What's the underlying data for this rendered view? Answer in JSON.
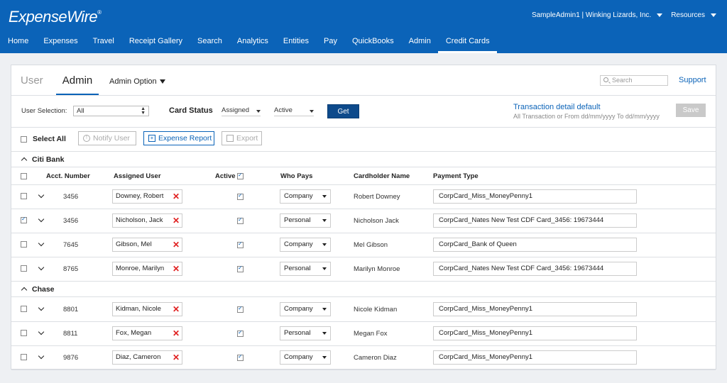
{
  "app": {
    "logo": "ExpenseWire",
    "logo_mark": "®"
  },
  "account": {
    "user": "SampleAdmin1 | Winking Lizards, Inc.",
    "resources": "Resources"
  },
  "nav": [
    {
      "label": "Home"
    },
    {
      "label": "Expenses"
    },
    {
      "label": "Travel"
    },
    {
      "label": "Receipt Gallery"
    },
    {
      "label": "Search"
    },
    {
      "label": "Analytics"
    },
    {
      "label": "Entities"
    },
    {
      "label": "Pay"
    },
    {
      "label": "QuickBooks"
    },
    {
      "label": "Admin"
    },
    {
      "label": "Credit Cards",
      "active": true
    }
  ],
  "tabs": {
    "user": "User",
    "admin": "Admin",
    "admin_option": "Admin Option"
  },
  "search": {
    "placeholder": "Search"
  },
  "support": "Support",
  "filters": {
    "user_selection_label": "User Selection:",
    "user_selection_value": "All",
    "card_status_label": "Card Status",
    "assigned_value": "Assigned",
    "active_value": "Active",
    "get_label": "Get",
    "transaction_title": "Transaction detail default",
    "transaction_sub": "All Transaction or From dd/mm/yyyy To dd/mm/yyyy",
    "save_label": "Save"
  },
  "actions": {
    "select_all": "Select All",
    "notify_user": "Notify User",
    "expense_report": "Expense Report",
    "export": "Export"
  },
  "columns": {
    "acct": "Acct. Number",
    "user": "Assigned User",
    "active": "Active",
    "who_pays": "Who Pays",
    "holder": "Cardholder Name",
    "payment": "Payment Type"
  },
  "groups": [
    {
      "name": "Citi Bank",
      "rows": [
        {
          "checked": false,
          "acct": "3456",
          "user": "Downey, Robert",
          "active": true,
          "pays": "Company",
          "holder": "Robert Downey",
          "payment": "CorpCard_Miss_MoneyPenny1"
        },
        {
          "checked": true,
          "acct": "3456",
          "user": "Nicholson, Jack",
          "active": true,
          "pays": "Personal",
          "holder": "Nicholson Jack",
          "payment": "CorpCard_Nates New Test CDF Card_3456: 19673444"
        },
        {
          "checked": false,
          "acct": "7645",
          "user": "Gibson, Mel",
          "active": true,
          "pays": "Company",
          "holder": "Mel Gibson",
          "payment": "CorpCard_Bank of Queen"
        },
        {
          "checked": false,
          "acct": "8765",
          "user": "Monroe, Marilyn",
          "active": true,
          "pays": "Personal",
          "holder": "Marilyn Monroe",
          "payment": "CorpCard_Nates New Test CDF Card_3456: 19673444"
        }
      ]
    },
    {
      "name": "Chase",
      "rows": [
        {
          "checked": false,
          "acct": "8801",
          "user": "Kidman, Nicole",
          "active": true,
          "pays": "Company",
          "holder": "Nicole Kidman",
          "payment": "CorpCard_Miss_MoneyPenny1"
        },
        {
          "checked": false,
          "acct": "8811",
          "user": "Fox, Megan",
          "active": true,
          "pays": "Personal",
          "holder": "Megan Fox",
          "payment": "CorpCard_Miss_MoneyPenny1"
        },
        {
          "checked": false,
          "acct": "9876",
          "user": "Diaz, Cameron",
          "active": true,
          "pays": "Company",
          "holder": "Cameron Diaz",
          "payment": "CorpCard_Miss_MoneyPenny1"
        }
      ]
    }
  ],
  "colors": {
    "brand": "#0b63b8",
    "remove": "#e02020"
  }
}
